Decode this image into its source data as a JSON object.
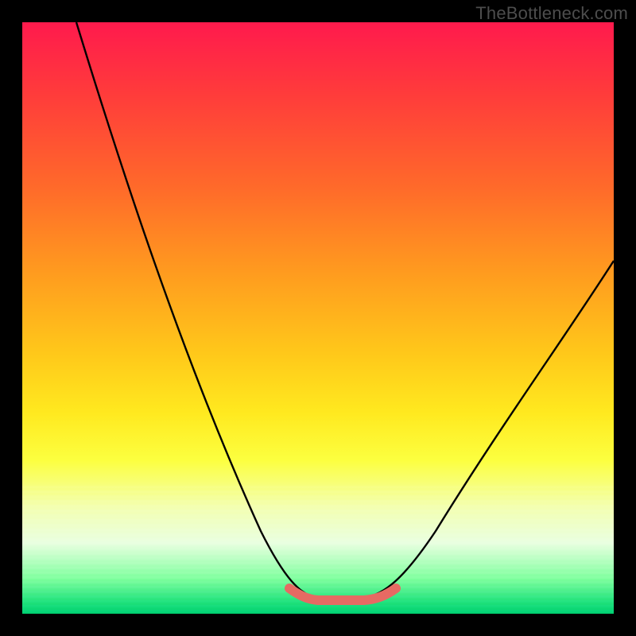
{
  "watermark": "TheBottleneck.com",
  "chart_data": {
    "type": "line",
    "title": "",
    "xlabel": "",
    "ylabel": "",
    "xlim": [
      0,
      100
    ],
    "ylim": [
      0,
      100
    ],
    "grid": false,
    "legend": false,
    "series": [
      {
        "name": "bottleneck-curve",
        "x": [
          0,
          5,
          10,
          15,
          20,
          25,
          30,
          35,
          40,
          45,
          48,
          50,
          52,
          55,
          58,
          60,
          65,
          70,
          75,
          80,
          85,
          90,
          95,
          100
        ],
        "values": [
          100,
          90,
          80,
          70,
          60,
          50,
          40,
          30,
          20,
          10,
          4,
          2,
          2,
          2,
          4,
          8,
          15,
          22,
          30,
          38,
          45,
          52,
          58,
          63
        ]
      },
      {
        "name": "valley-highlight",
        "x": [
          46,
          48,
          50,
          52,
          54,
          56,
          58
        ],
        "values": [
          4,
          2,
          2,
          2,
          2,
          3,
          4
        ]
      }
    ],
    "gradient_colormap": "red-yellow-green (vertical)"
  }
}
